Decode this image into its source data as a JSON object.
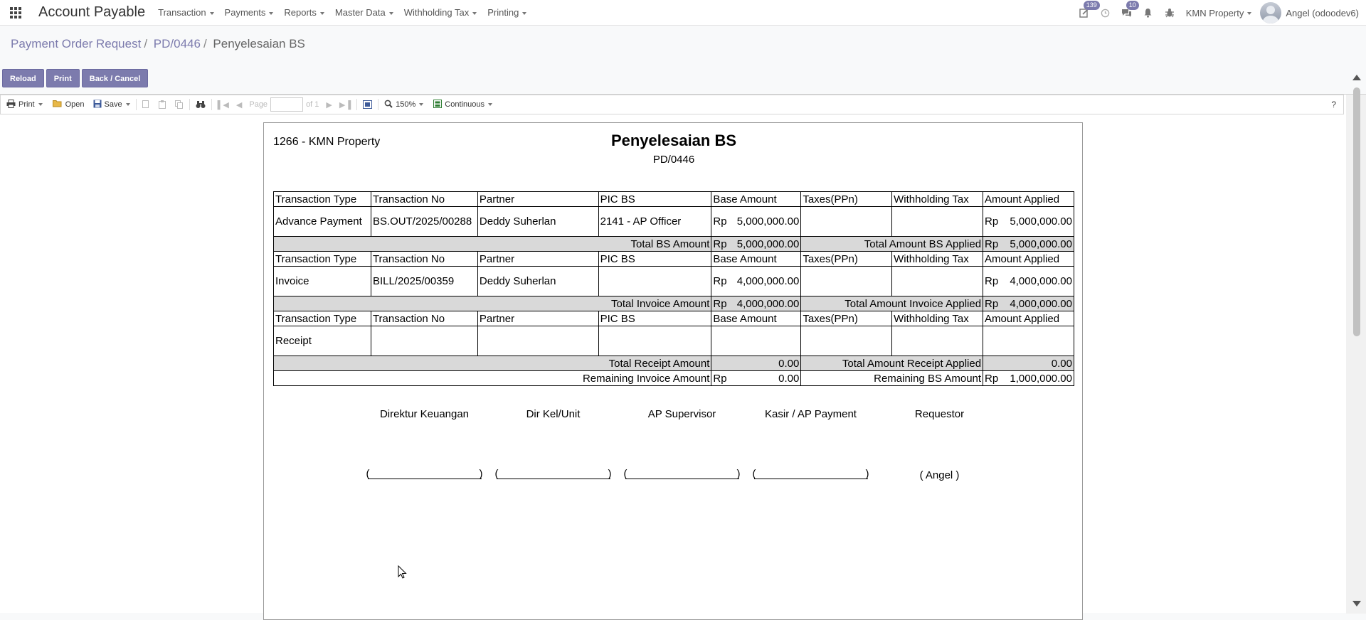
{
  "navbar": {
    "brand": "Account Payable",
    "menu": [
      "Transaction",
      "Payments",
      "Reports",
      "Master Data",
      "Withholding Tax",
      "Printing"
    ],
    "activity_badge": "139",
    "messages_badge": "10",
    "company": "KMN Property",
    "user": "Angel (odoodev6)"
  },
  "breadcrumb": {
    "items": [
      "Payment Order Request",
      "PD/0446"
    ],
    "current": "Penyelesaian BS"
  },
  "buttons": {
    "reload": "Reload",
    "print": "Print",
    "back": "Back / Cancel"
  },
  "toolbar": {
    "print": "Print",
    "open": "Open",
    "save": "Save",
    "page_label": "Page",
    "of_pages": "of 1",
    "zoom": "150%",
    "mode": "Continuous",
    "help": "?"
  },
  "document": {
    "company": "1266 - KMN Property",
    "title": "Penyelesaian BS",
    "number": "PD/0446",
    "headers": [
      "Transaction Type",
      "Transaction No",
      "Partner",
      "PIC BS",
      "Base Amount",
      "Taxes(PPn)",
      "Withholding Tax",
      "Amount Applied"
    ],
    "sections": [
      {
        "type": "Advance Payment",
        "no": "BS.OUT/2025/00288",
        "partner": "Deddy Suherlan",
        "pic": "2141 - AP Officer",
        "base_cur": "Rp",
        "base": "5,000,000.00",
        "applied_cur": "Rp",
        "applied": "5,000,000.00",
        "total_label": "Total BS Amount",
        "total_cur": "Rp",
        "total": "5,000,000.00",
        "total_applied_label": "Total Amount BS Applied",
        "total_applied_cur": "Rp",
        "total_applied": "5,000,000.00"
      },
      {
        "type": "Invoice",
        "no": "BILL/2025/00359",
        "partner": "Deddy Suherlan",
        "pic": "",
        "base_cur": "Rp",
        "base": "4,000,000.00",
        "applied_cur": "Rp",
        "applied": "4,000,000.00",
        "total_label": "Total Invoice Amount",
        "total_cur": "Rp",
        "total": "4,000,000.00",
        "total_applied_label": "Total Amount Invoice Applied",
        "total_applied_cur": "Rp",
        "total_applied": "4,000,000.00"
      },
      {
        "type": "Receipt",
        "total_label": "Total Receipt Amount",
        "total": "0.00",
        "total_applied_label": "Total Amount Receipt Applied",
        "total_applied": "0.00"
      }
    ],
    "remaining": {
      "invoice_label": "Remaining Invoice Amount",
      "invoice_cur": "Rp",
      "invoice": "0.00",
      "bs_label": "Remaining BS Amount",
      "bs_cur": "Rp",
      "bs": "1,000,000.00"
    },
    "signatures": [
      {
        "role": "Direktur Keuangan"
      },
      {
        "role": "Dir Kel/Unit"
      },
      {
        "role": "AP Supervisor"
      },
      {
        "role": "Kasir / AP Payment"
      },
      {
        "role": "Requestor",
        "name": "( Angel )"
      }
    ]
  }
}
